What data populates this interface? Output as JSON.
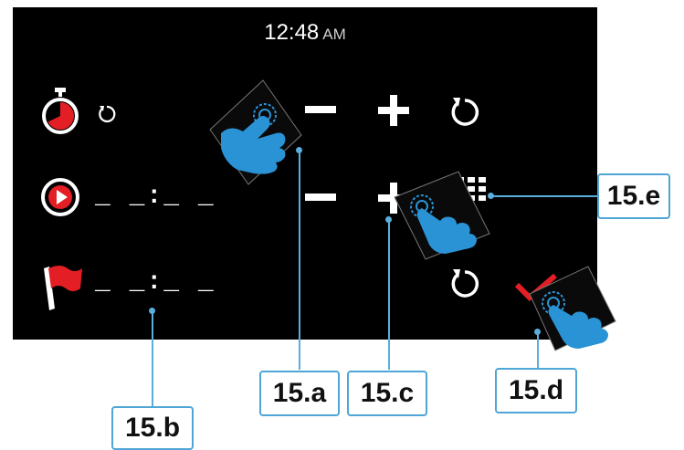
{
  "status_bar": {
    "time": "12:48",
    "ampm": "AM"
  },
  "rows": [
    {
      "icon": "timer-icon",
      "value": ""
    },
    {
      "icon": "play-circle-icon",
      "value": "_ _:_ _"
    },
    {
      "icon": "red-flag-icon",
      "value": "_ _:_ _"
    }
  ],
  "controls": {
    "minus": "minus-button",
    "plus": "plus-button",
    "reset": "reset-icon",
    "keypad": "keypad-icon",
    "confirm": "checkmark-icon"
  },
  "callouts": {
    "a": "15.a",
    "b": "15.b",
    "c": "15.c",
    "d": "15.d",
    "e": "15.e"
  },
  "colors": {
    "screen": "#000000",
    "accent_red": "#e31e24",
    "hand_blue": "#2a93d5",
    "callout_border": "#4fa6d6"
  }
}
